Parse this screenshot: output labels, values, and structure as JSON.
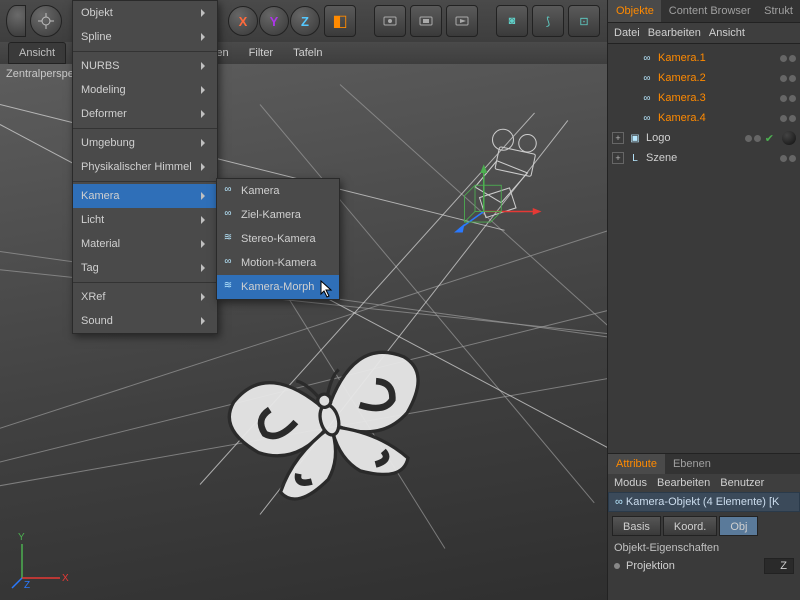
{
  "toolbar": {
    "axis_x": "X",
    "axis_y": "Y",
    "axis_z": "Z"
  },
  "viewport": {
    "tab_label": "Ansicht",
    "perspective_label": "Zentralperspe",
    "menus": [
      "Optionen",
      "Filter",
      "Tafeln"
    ],
    "axis_labels": {
      "x": "X",
      "y": "Y",
      "z": "Z"
    }
  },
  "main_menu": {
    "items": [
      {
        "label": "Objekt",
        "sub": true
      },
      {
        "label": "Spline",
        "sub": true
      },
      {
        "sep": true
      },
      {
        "label": "NURBS",
        "sub": true
      },
      {
        "label": "Modeling",
        "sub": true
      },
      {
        "label": "Deformer",
        "sub": true
      },
      {
        "sep": true
      },
      {
        "label": "Umgebung",
        "sub": true
      },
      {
        "label": "Physikalischer Himmel",
        "sub": true
      },
      {
        "sep": true
      },
      {
        "label": "Kamera",
        "sub": true,
        "hov": true
      },
      {
        "label": "Licht",
        "sub": true
      },
      {
        "label": "Material",
        "sub": true
      },
      {
        "label": "Tag",
        "sub": true
      },
      {
        "sep": true
      },
      {
        "label": "XRef",
        "sub": true
      },
      {
        "label": "Sound",
        "sub": true
      }
    ]
  },
  "sub_menu": {
    "items": [
      {
        "label": "Kamera",
        "ico": "∞"
      },
      {
        "label": "Ziel-Kamera",
        "ico": "∞"
      },
      {
        "label": "Stereo-Kamera",
        "ico": "≋"
      },
      {
        "label": "Motion-Kamera",
        "ico": "∞"
      },
      {
        "label": "Kamera-Morph",
        "ico": "≋",
        "hov": true
      }
    ]
  },
  "right_panel": {
    "tabs": [
      "Objekte",
      "Content Browser",
      "Strukt"
    ],
    "active_tab": 0,
    "menus": [
      "Datei",
      "Bearbeiten",
      "Ansicht"
    ],
    "objects": [
      {
        "name": "Kamera.1",
        "ico": "∞",
        "color": "orange",
        "indent": 1
      },
      {
        "name": "Kamera.2",
        "ico": "∞",
        "color": "orange",
        "indent": 1
      },
      {
        "name": "Kamera.3",
        "ico": "∞",
        "color": "orange",
        "indent": 1
      },
      {
        "name": "Kamera.4",
        "ico": "∞",
        "color": "orange",
        "indent": 1
      },
      {
        "name": "Logo",
        "ico": "▣",
        "color": "white",
        "indent": 0,
        "exp": "+",
        "check": true,
        "tag": true
      },
      {
        "name": "Szene",
        "ico": "L",
        "color": "white",
        "indent": 0,
        "exp": "+"
      }
    ]
  },
  "attributes": {
    "tabs": [
      "Attribute",
      "Ebenen"
    ],
    "active_tab": 0,
    "menus": [
      "Modus",
      "Bearbeiten",
      "Benutzer"
    ],
    "header": "Kamera-Objekt (4 Elemente) [K",
    "header_icon": "∞",
    "btns": [
      "Basis",
      "Koord.",
      "Obj"
    ],
    "active_btn": 2,
    "section": "Objekt-Eigenschaften",
    "fields": [
      {
        "label": "Projektion",
        "value": "Z"
      }
    ]
  }
}
